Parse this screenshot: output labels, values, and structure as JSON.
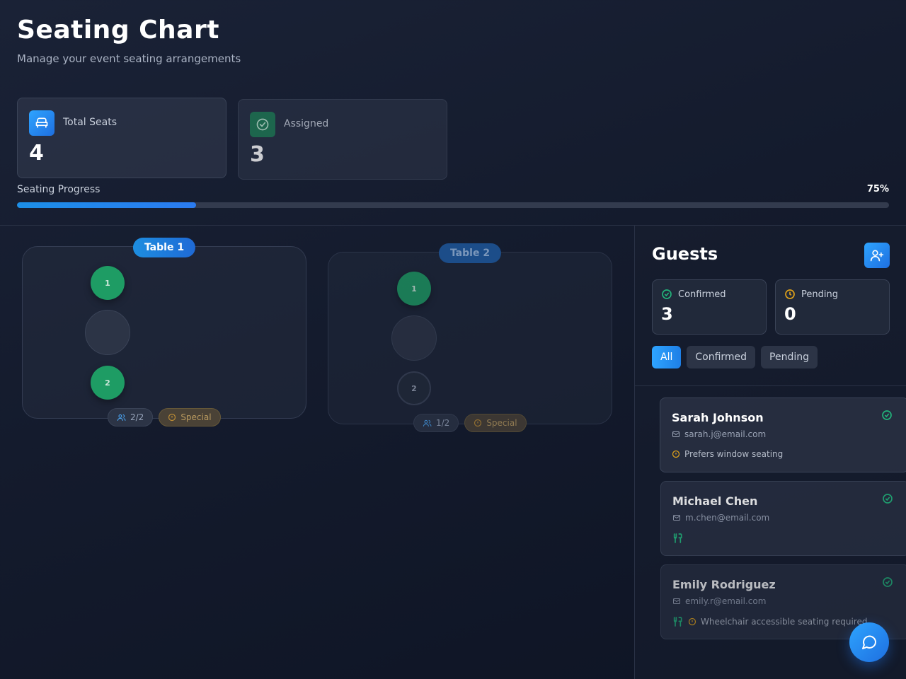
{
  "header": {
    "title": "Seating Chart",
    "subtitle": "Manage your event seating arrangements"
  },
  "stats": [
    {
      "label": "Total Seats",
      "value": "4",
      "icon": "seat-icon",
      "color": "#2ea4ff"
    },
    {
      "label": "Assigned",
      "value": "3",
      "icon": "check-circle-icon",
      "color": "#1f7a55"
    }
  ],
  "progress": {
    "label": "Seating Progress",
    "percent_label": "75%",
    "value": 0.205
  },
  "tables": [
    {
      "name": "Table 1",
      "seats": [
        "1",
        "2"
      ],
      "count": "2/2",
      "special": "Special"
    },
    {
      "name": "Table 2",
      "seats": [
        "1",
        "2"
      ],
      "count": "1/2",
      "special": "Special"
    }
  ],
  "sidebar": {
    "title": "Guests",
    "confirmed_label": "Confirmed",
    "confirmed_value": "3",
    "pending_label": "Pending",
    "pending_value": "0",
    "filters": [
      "All",
      "Confirmed",
      "Pending"
    ]
  },
  "guests": [
    {
      "name": "Sarah Johnson",
      "email": "sarah.j@email.com",
      "note": "Prefers window seating"
    },
    {
      "name": "Michael Chen",
      "email": "m.chen@email.com",
      "note": ""
    },
    {
      "name": "Emily Rodriguez",
      "email": "emily.r@email.com",
      "note": "Wheelchair accessible seating required"
    }
  ],
  "colors": {
    "accent": "#2ea4ff",
    "success": "#1e9c64",
    "warning": "#e0a21a"
  }
}
